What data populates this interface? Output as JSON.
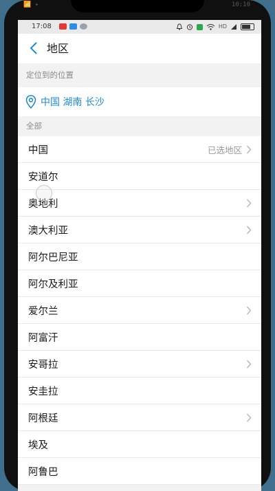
{
  "frame": {
    "ghost_left": "📶 ✦ ",
    "ghost_right": "10:10"
  },
  "status_bar": {
    "time": "17:08",
    "hd_label": "HD"
  },
  "header": {
    "title": "地区"
  },
  "sections": {
    "located_header": "定位到的位置",
    "all_header": "全部"
  },
  "located": {
    "text": "中国 湖南 长沙"
  },
  "countries": [
    {
      "name": "中国",
      "status": "已选地区",
      "chevron": true
    },
    {
      "name": "安道尔",
      "status": "",
      "chevron": false
    },
    {
      "name": "奥地利",
      "status": "",
      "chevron": true
    },
    {
      "name": "澳大利亚",
      "status": "",
      "chevron": true
    },
    {
      "name": "阿尔巴尼亚",
      "status": "",
      "chevron": false
    },
    {
      "name": "阿尔及利亚",
      "status": "",
      "chevron": false
    },
    {
      "name": "爱尔兰",
      "status": "",
      "chevron": true
    },
    {
      "name": "阿富汗",
      "status": "",
      "chevron": false
    },
    {
      "name": "安哥拉",
      "status": "",
      "chevron": true
    },
    {
      "name": "安圭拉",
      "status": "",
      "chevron": false
    },
    {
      "name": "阿根廷",
      "status": "",
      "chevron": true
    },
    {
      "name": "埃及",
      "status": "",
      "chevron": false
    },
    {
      "name": "阿鲁巴",
      "status": "",
      "chevron": false
    }
  ],
  "colors": {
    "accent": "#1f8ad6",
    "background": "#f2f2f2"
  }
}
